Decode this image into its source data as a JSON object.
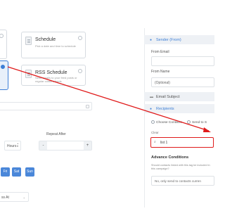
{
  "schedule_card": {
    "title": "Schedule",
    "description": "Pick a date and time to schedule"
  },
  "rss_card": {
    "title": "RSS Schedule",
    "description": "Send emails to your feed posts or regular content feeds"
  },
  "interval": {
    "unit": "Hours",
    "repeat_after_label": "Repeat After",
    "minus": "-",
    "plus": "+"
  },
  "days": [
    "Fri",
    "Sat",
    "Sun"
  ],
  "starts_at": {
    "label": "ss At",
    "caret": "⌄"
  },
  "sender": {
    "section_label": "Sender (From)",
    "from_email_label": "From Email",
    "from_name_label": "From Name",
    "from_name_value": "(Optional)"
  },
  "email_subject": {
    "section_label": "Email Subject"
  },
  "recipients": {
    "section_label": "Recipients",
    "option_choose_contacts": "Choose Contacts",
    "option_send_to": "Send to S",
    "clear_label": "Clear",
    "list_value": "list 1"
  },
  "advanced": {
    "title": "Advance Conditions",
    "description": "Should contacts linked with this tag be included in this campaign?",
    "option_value": "No, only send to contacts curren"
  },
  "colors": {
    "accent": "#4a87d9",
    "highlight": "#e01b1b"
  }
}
